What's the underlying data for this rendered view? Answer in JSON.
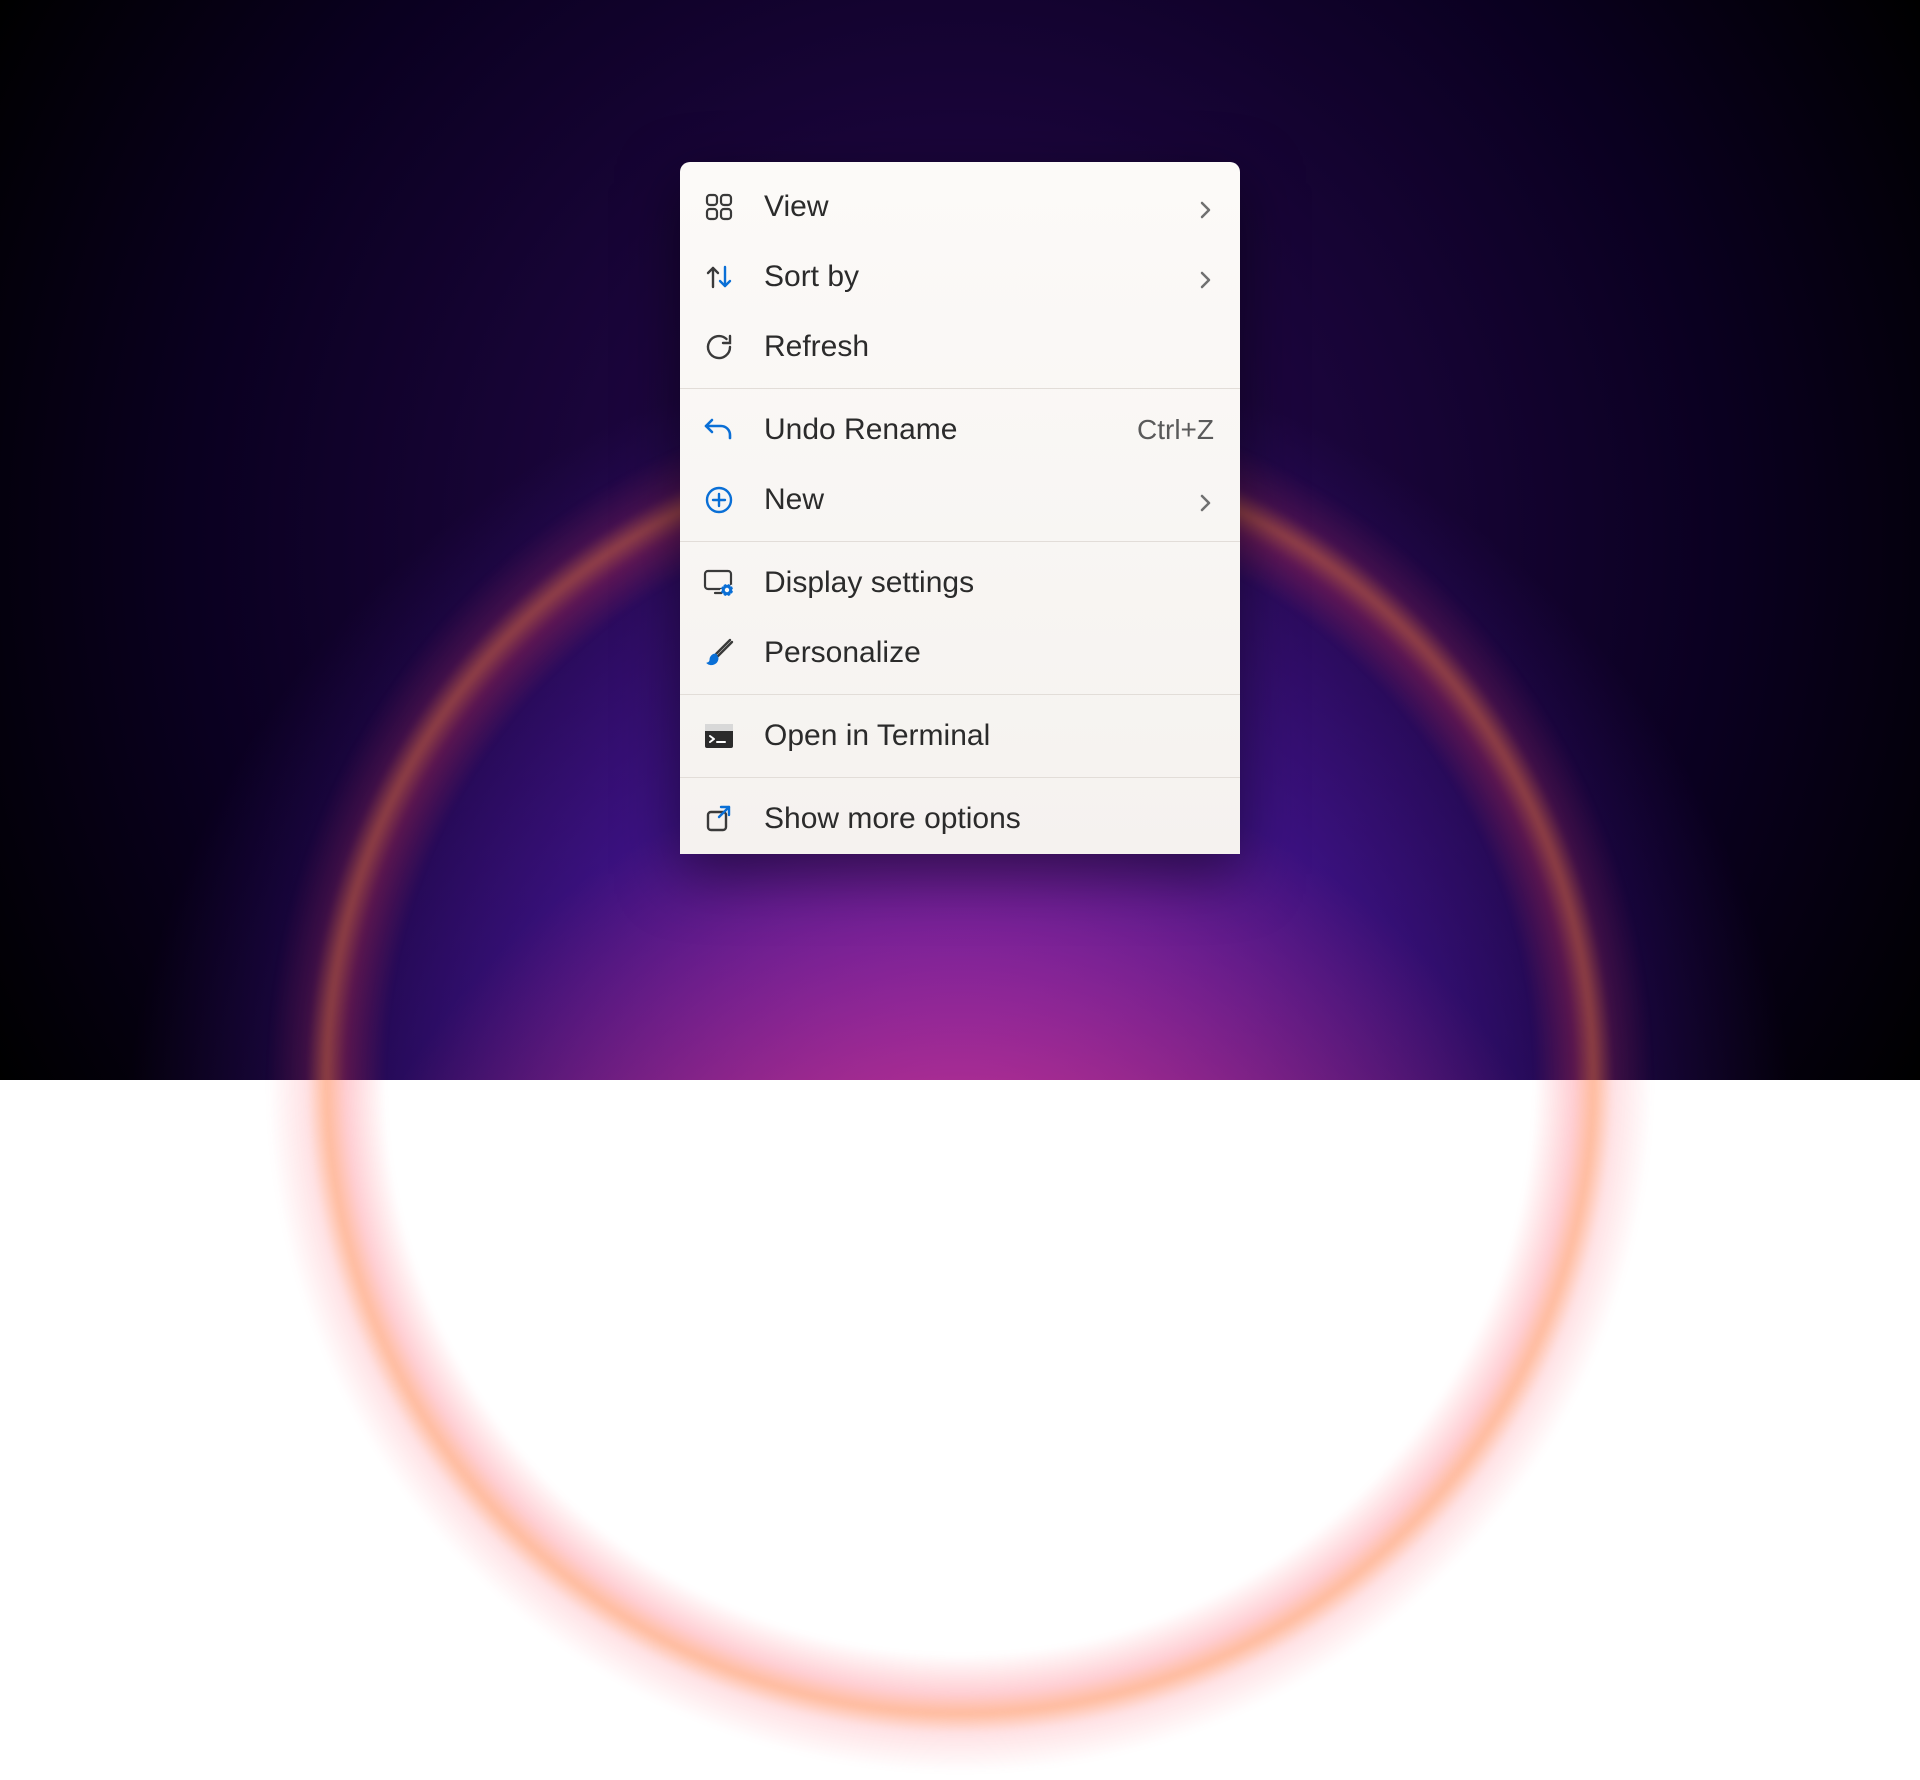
{
  "menu": {
    "items": [
      {
        "label": "View",
        "icon": "grid-icon",
        "submenu": true
      },
      {
        "label": "Sort by",
        "icon": "sort-icon",
        "submenu": true
      },
      {
        "label": "Refresh",
        "icon": "refresh-icon"
      },
      {
        "label": "Undo Rename",
        "icon": "undo-icon",
        "shortcut": "Ctrl+Z"
      },
      {
        "label": "New",
        "icon": "plus-circle-icon",
        "submenu": true
      },
      {
        "label": "Display settings",
        "icon": "display-settings-icon"
      },
      {
        "label": "Personalize",
        "icon": "paintbrush-icon"
      },
      {
        "label": "Open in Terminal",
        "icon": "terminal-icon"
      },
      {
        "label": "Show more options",
        "icon": "expand-icon"
      }
    ]
  }
}
